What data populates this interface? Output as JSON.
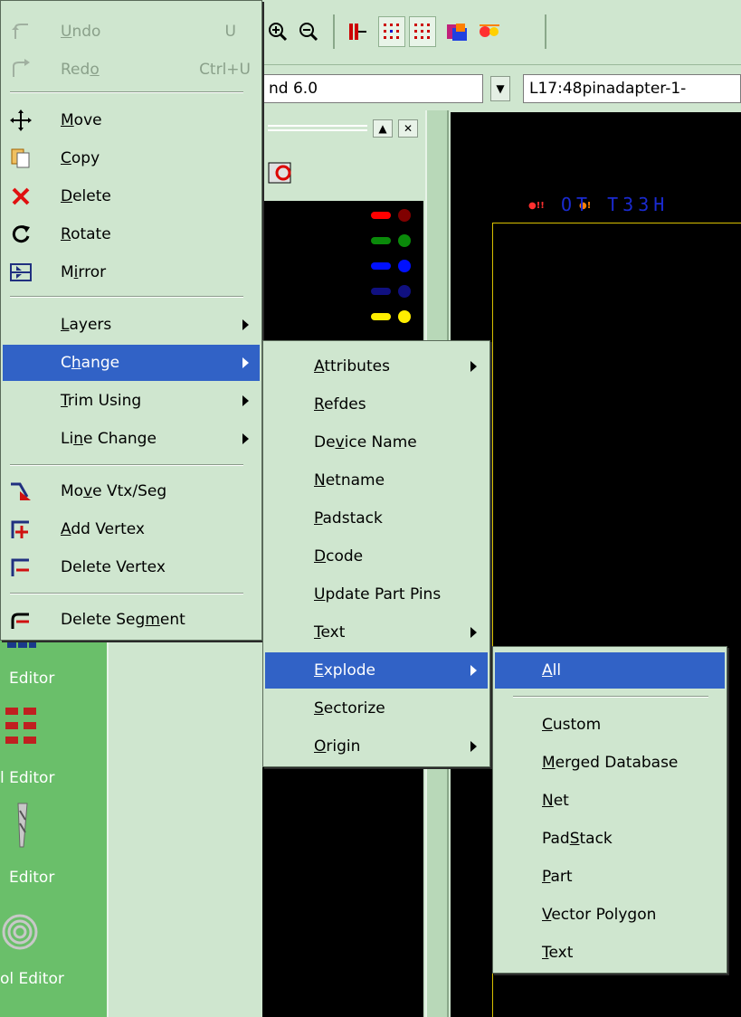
{
  "toolbar": {
    "buttons": [
      "zoom-in-icon",
      "zoom-out-icon",
      "route-icon",
      "grid-icon",
      "grid-alt-icon",
      "layers-color-icon",
      "highlight-icon"
    ]
  },
  "combos": {
    "left_value": "nd 6.0",
    "right_value": "L17:48pinadapter-1-"
  },
  "canvas": {
    "silk_text": "OT  T33H",
    "accent_colors": {
      "board_outline": "#d8c000",
      "silk": "#1a2ad0"
    }
  },
  "layer_swatches": [
    "#ff0000",
    "#0a8a0a",
    "#0010ff",
    "#101080",
    "#ffee00"
  ],
  "left_strip": {
    "labels": [
      "Editor",
      "l Editor",
      "Editor",
      "ol Editor"
    ]
  },
  "context_menu": {
    "undo": {
      "label": "Undo",
      "underline": "U",
      "rest": "ndo",
      "shortcut": "U"
    },
    "redo": {
      "label": "Redo",
      "pre": "Red",
      "underline": "o",
      "shortcut": "Ctrl+U"
    },
    "move": {
      "underline": "M",
      "rest": "ove"
    },
    "copy": {
      "underline": "C",
      "rest": "opy"
    },
    "delete": {
      "underline": "D",
      "rest": "elete"
    },
    "rotate": {
      "underline": "R",
      "rest": "otate"
    },
    "mirror": {
      "pre": "M",
      "underline": "i",
      "rest": "rror"
    },
    "layers": {
      "underline": "L",
      "rest": "ayers"
    },
    "change": {
      "pre": "C",
      "underline": "h",
      "rest": "ange"
    },
    "trim": {
      "underline": "T",
      "rest": "rim Using"
    },
    "line_change": {
      "pre": "Li",
      "underline": "n",
      "rest": "e Change"
    },
    "move_vtx": {
      "pre": "Mo",
      "underline": "v",
      "rest": "e Vtx/Seg"
    },
    "add_vertex": {
      "underline": "A",
      "rest": "dd Vertex"
    },
    "delete_vertex": {
      "label": "Delete Vertex"
    },
    "delete_segment": {
      "pre": "Delete Seg",
      "underline": "m",
      "rest": "ent"
    }
  },
  "change_menu": {
    "attributes": {
      "underline": "A",
      "rest": "ttributes"
    },
    "refdes": {
      "underline": "R",
      "rest": "efdes"
    },
    "device_name": {
      "pre": "De",
      "underline": "v",
      "rest": "ice Name"
    },
    "netname": {
      "underline": "N",
      "rest": "etname"
    },
    "padstack": {
      "underline": "P",
      "rest": "adstack"
    },
    "dcode": {
      "underline": "D",
      "rest": "code"
    },
    "update_part_pins": {
      "underline": "U",
      "rest": "pdate Part Pins"
    },
    "text": {
      "underline": "T",
      "rest": "ext"
    },
    "explode": {
      "underline": "E",
      "rest": "xplode"
    },
    "sectorize": {
      "underline": "S",
      "rest": "ectorize"
    },
    "origin": {
      "underline": "O",
      "rest": "rigin"
    }
  },
  "explode_menu": {
    "all": {
      "underline": "A",
      "rest": "ll"
    },
    "custom": {
      "underline": "C",
      "rest": "ustom"
    },
    "merged_database": {
      "underline": "M",
      "rest": "erged Database"
    },
    "net": {
      "underline": "N",
      "rest": "et"
    },
    "padstack": {
      "pre": "Pad",
      "underline": "S",
      "rest": "tack"
    },
    "part": {
      "underline": "P",
      "rest": "art"
    },
    "vector_polygon": {
      "underline": "V",
      "rest": "ector Polygon"
    },
    "text": {
      "underline": "T",
      "rest": "ext"
    }
  }
}
